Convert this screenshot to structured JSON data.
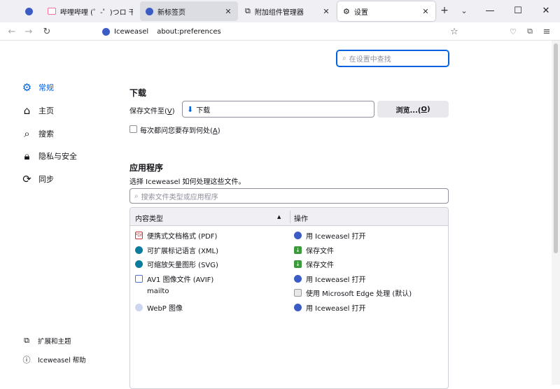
{
  "tabs": [
    {
      "title": "",
      "icon": "iceweasel-icon"
    },
    {
      "title": "哔哩哔哩 (゜-゜)つロ 干杯~",
      "icon": "bilibili-icon"
    },
    {
      "title": "新标签页",
      "icon": "iceweasel-icon"
    },
    {
      "title": "附加组件管理器",
      "icon": "puzzle-icon"
    },
    {
      "title": "设置",
      "icon": "gear-icon"
    }
  ],
  "navbar": {
    "identity": "Iceweasel",
    "url": "about:preferences"
  },
  "search": {
    "placeholder": "在设置中查找"
  },
  "sidebar": {
    "items": [
      {
        "label": "常规",
        "icon": "gear-icon"
      },
      {
        "label": "主页",
        "icon": "home-icon"
      },
      {
        "label": "搜索",
        "icon": "search-icon"
      },
      {
        "label": "隐私与安全",
        "icon": "lock-icon"
      },
      {
        "label": "同步",
        "icon": "sync-icon"
      }
    ],
    "footer": [
      {
        "label": "扩展和主题",
        "icon": "puzzle-icon"
      },
      {
        "label": "Iceweasel 帮助",
        "icon": "help-icon"
      }
    ]
  },
  "downloads": {
    "heading": "下载",
    "save_to_label": "保存文件至(",
    "save_to_key": "V",
    "save_to_suffix": ")",
    "folder": "下载",
    "browse_label": "浏览...(",
    "browse_key": "O",
    "browse_suffix": ")",
    "ask_label": "每次都问您要存到何处(",
    "ask_key": "A",
    "ask_suffix": ")",
    "ask_checked": false
  },
  "applications": {
    "heading": "应用程序",
    "description": "选择 Iceweasel 如何处理这些文件。",
    "filter_placeholder": "搜索文件类型或应用程序",
    "columns": {
      "type": "内容类型",
      "action": "操作"
    },
    "rows": [
      {
        "type": "便携式文档格式 (PDF)",
        "type_icon": "pdf-icon",
        "action": "用 Iceweasel 打开",
        "action_icon": "iceweasel-icon"
      },
      {
        "type": "可扩展标记语言 (XML)",
        "type_icon": "edge-icon",
        "action": "保存文件",
        "action_icon": "save-icon"
      },
      {
        "type": "可缩放矢量图形 (SVG)",
        "type_icon": "edge-icon",
        "action": "保存文件",
        "action_icon": "save-icon"
      },
      {
        "type": "AV1 图像文件 (AVIF)",
        "type_icon": "file-icon",
        "action": "用 Iceweasel 打开",
        "action_icon": "iceweasel-icon"
      },
      {
        "type": "mailto",
        "type_icon": "",
        "action": "使用 Microsoft Edge 处理 (默认)",
        "action_icon": "app-icon"
      },
      {
        "type": "WebP 图像",
        "type_icon": "image-icon",
        "action": "用 Iceweasel 打开",
        "action_icon": "iceweasel-icon"
      }
    ]
  },
  "colors": {
    "accent": "#0061e0",
    "tabstrip": "#f0f0f4"
  }
}
